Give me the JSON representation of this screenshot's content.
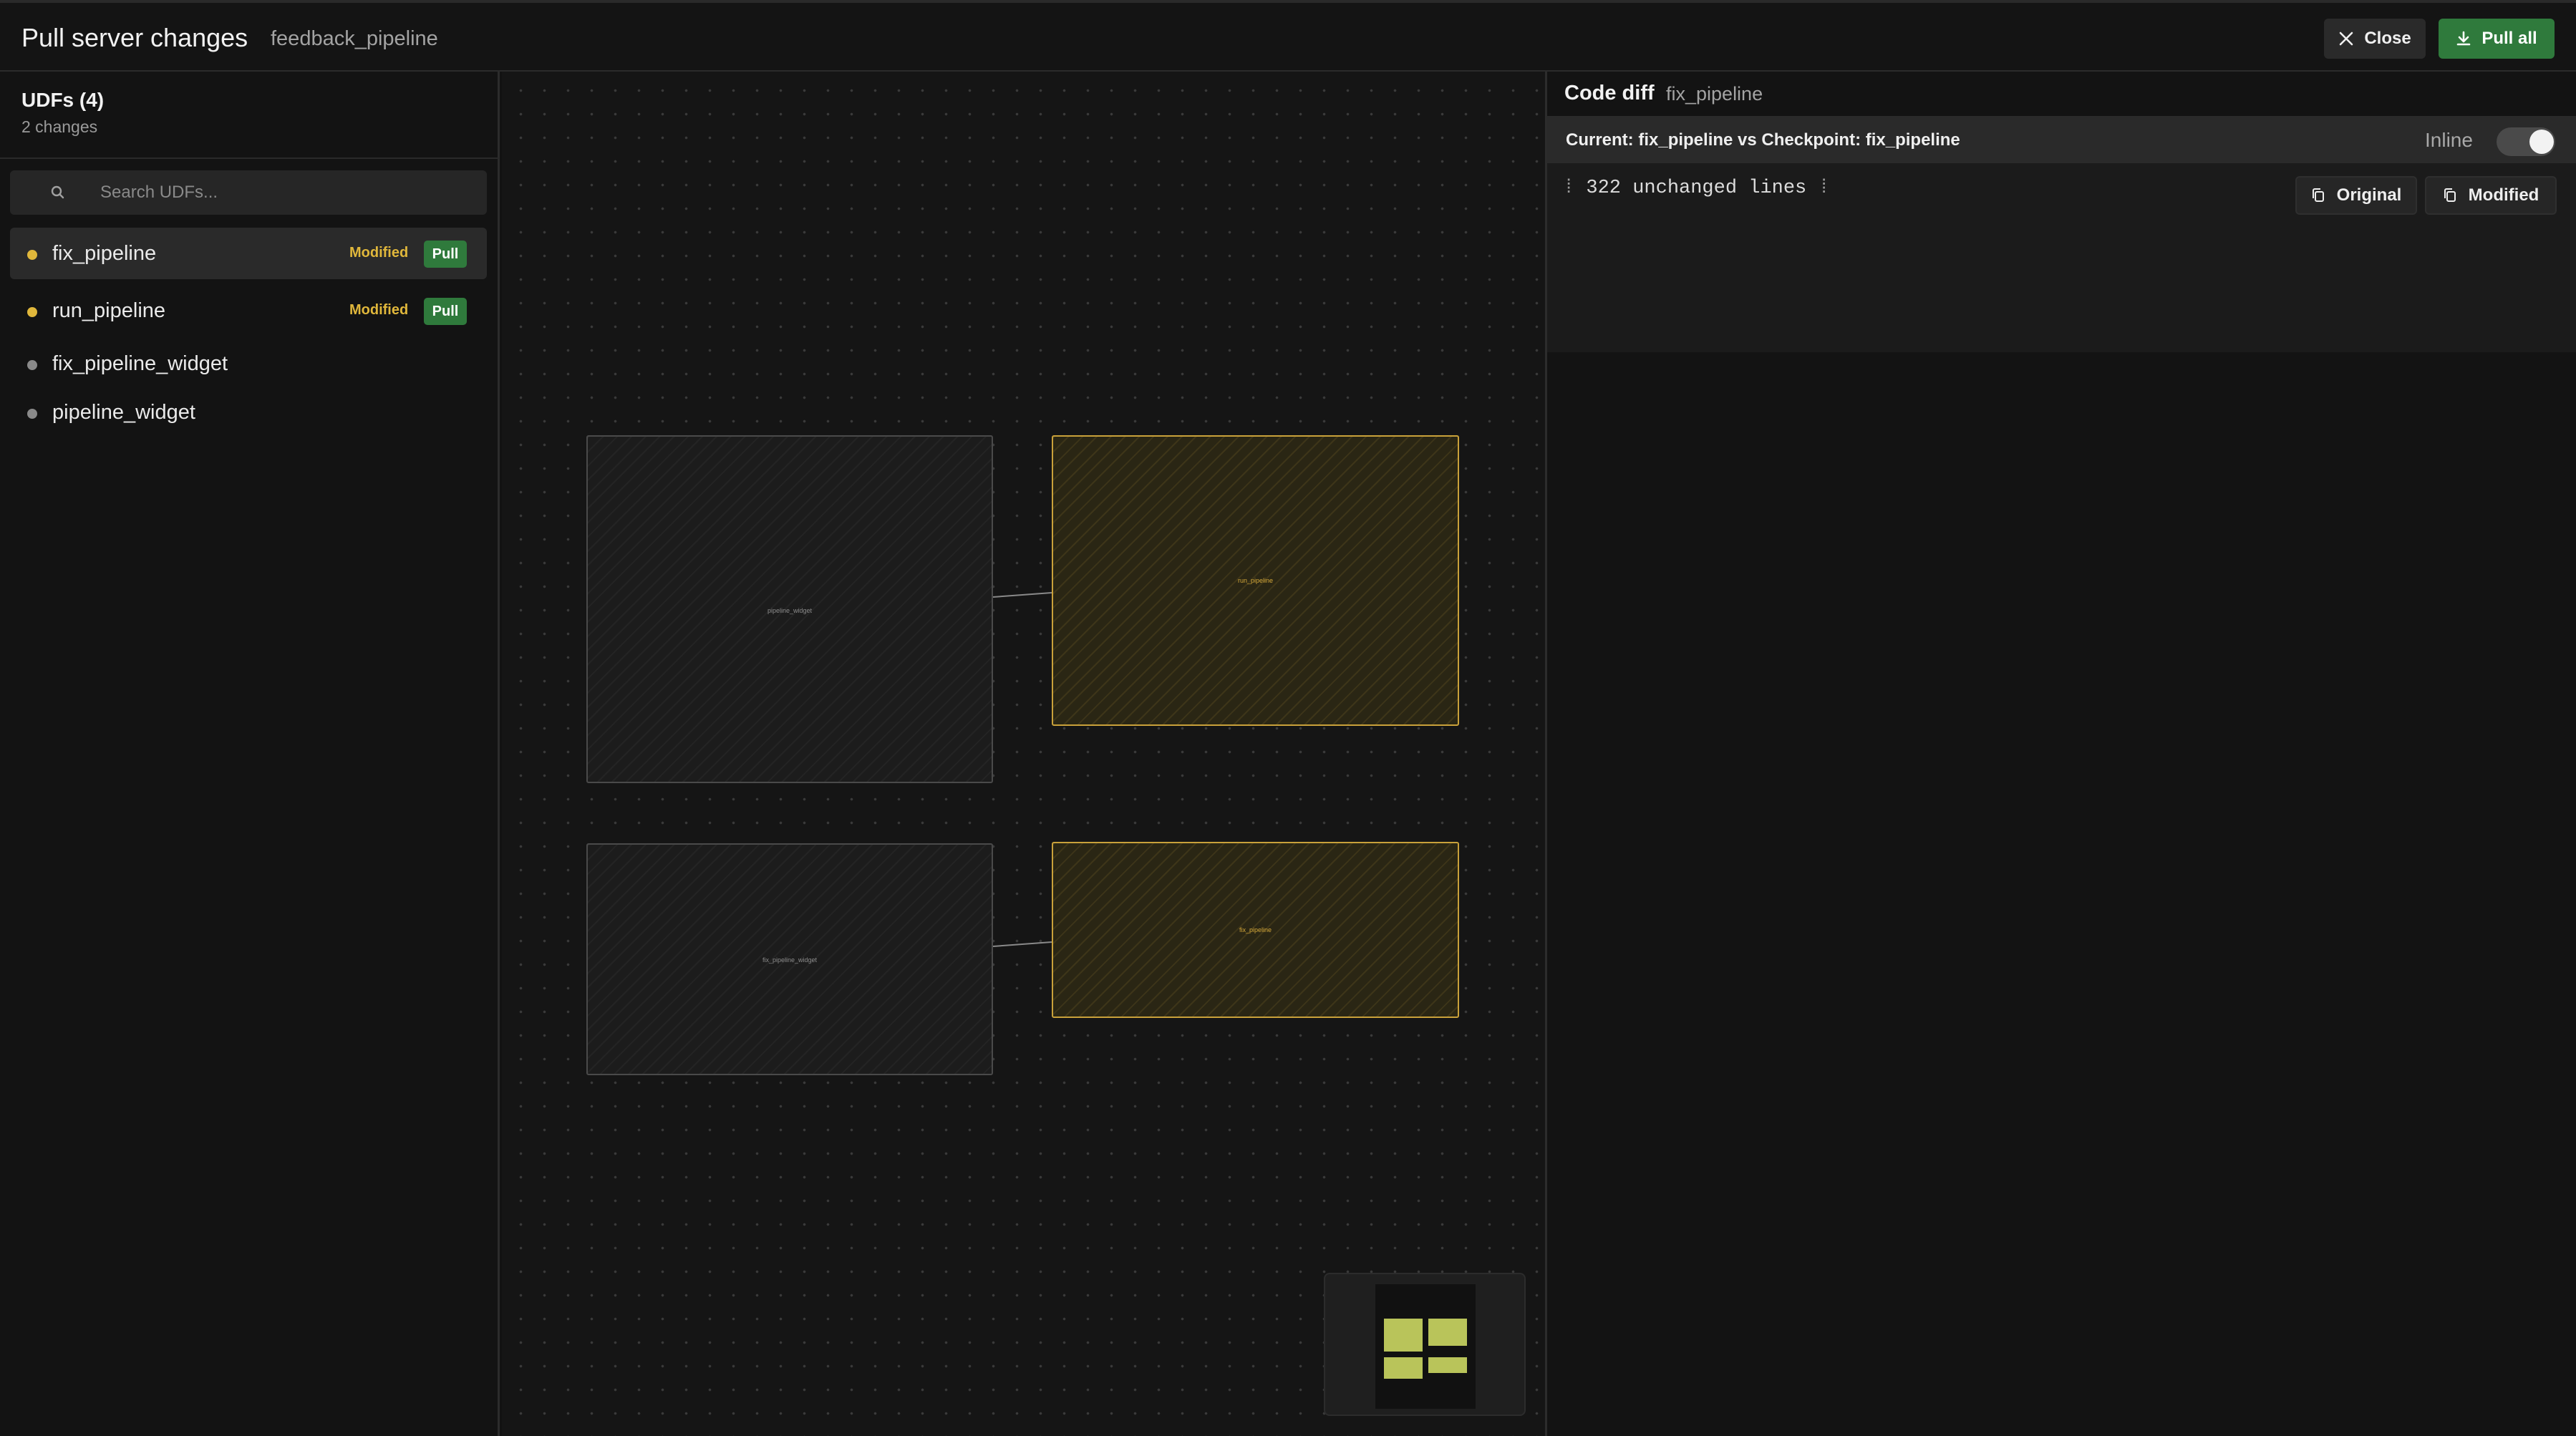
{
  "header": {
    "title": "Pull server changes",
    "subtitle": "feedback_pipeline",
    "close_label": "Close",
    "pull_all_label": "Pull all"
  },
  "sidebar": {
    "title": "UDFs (4)",
    "subtitle": "2 changes",
    "search_placeholder": "Search UDFs...",
    "items": [
      {
        "name": "fix_pipeline",
        "status": "Modified",
        "action": "Pull",
        "selected": true,
        "dot_color": "#e0b73b"
      },
      {
        "name": "run_pipeline",
        "status": "Modified",
        "action": "Pull",
        "selected": false,
        "dot_color": "#e0b73b"
      },
      {
        "name": "fix_pipeline_widget",
        "selected": false,
        "dot_color": "#8a8a8a"
      },
      {
        "name": "pipeline_widget",
        "selected": false,
        "dot_color": "#8a8a8a"
      }
    ]
  },
  "canvas": {
    "nodes": [
      {
        "label": "pipeline_widget",
        "changed": false
      },
      {
        "label": "run_pipeline",
        "changed": true
      },
      {
        "label": "fix_pipeline_widget",
        "changed": false
      },
      {
        "label": "fix_pipeline",
        "changed": true
      }
    ]
  },
  "diff": {
    "title": "Code diff",
    "subtitle": "fix_pipeline",
    "compare_label": "Current: fix_pipeline vs Checkpoint: fix_pipeline",
    "inline_label": "Inline",
    "inline_enabled": true,
    "unchanged_text": "322 unchanged lines",
    "original_label": "Original",
    "modified_label": "Modified"
  },
  "colors": {
    "accent_green": "#2f7a3c",
    "modified_yellow": "#e0b73b"
  }
}
